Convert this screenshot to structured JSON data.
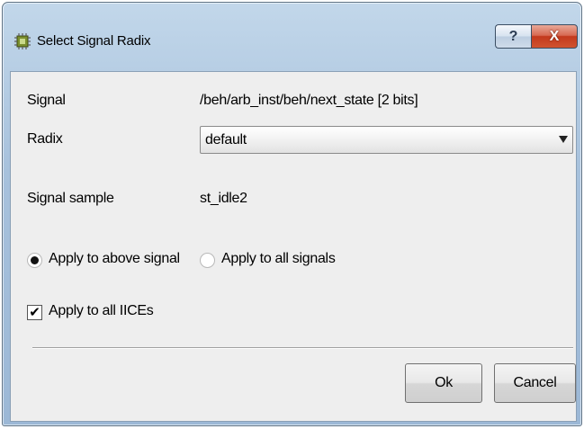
{
  "window": {
    "title": "Select Signal Radix",
    "app_icon": "chip-icon",
    "help_label": "?",
    "close_label": "X"
  },
  "form": {
    "signal_label": "Signal",
    "signal_value": "/beh/arb_inst/beh/next_state [2 bits]",
    "radix_label": "Radix",
    "radix_selected": "default",
    "sample_label": "Signal sample",
    "sample_value": "st_idle2"
  },
  "options": {
    "apply_above_label": "Apply to above signal",
    "apply_above_selected": true,
    "apply_all_label": "Apply to all signals",
    "apply_all_selected": false,
    "apply_iices_label": "Apply to all IICEs",
    "apply_iices_checked": true
  },
  "buttons": {
    "ok_label": "Ok",
    "cancel_label": "Cancel"
  }
}
